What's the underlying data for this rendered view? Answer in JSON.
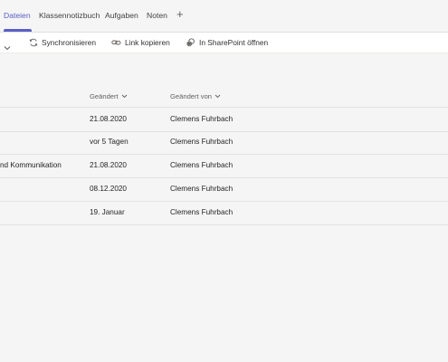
{
  "tabs": [
    {
      "label": "Dateien",
      "active": true
    },
    {
      "label": "Klassennotizbuch",
      "active": false
    },
    {
      "label": "Aufgaben",
      "active": false
    },
    {
      "label": "Noten",
      "active": false
    }
  ],
  "add_tab_symbol": "+",
  "toolbar": {
    "sync_label": "Synchronisieren",
    "copy_link_label": "Link kopieren",
    "open_sharepoint_label": "In SharePoint öffnen"
  },
  "table": {
    "columns": {
      "modified": "Geändert",
      "modified_by": "Geändert von"
    },
    "rows": [
      {
        "name": "",
        "modified": "21.08.2020",
        "modified_by": "Clemens Fuhrbach"
      },
      {
        "name": "",
        "modified": "vor 5 Tagen",
        "modified_by": "Clemens Fuhrbach"
      },
      {
        "name": "nd Kommunikation",
        "modified": "21.08.2020",
        "modified_by": "Clemens Fuhrbach"
      },
      {
        "name": "",
        "modified": "08.12.2020",
        "modified_by": "Clemens Fuhrbach"
      },
      {
        "name": "",
        "modified": "19. Januar",
        "modified_by": "Clemens Fuhrbach"
      }
    ]
  },
  "colors": {
    "accent": "#5b5fc7",
    "background": "#f5f5f5",
    "toolbar": "#ffffff"
  }
}
